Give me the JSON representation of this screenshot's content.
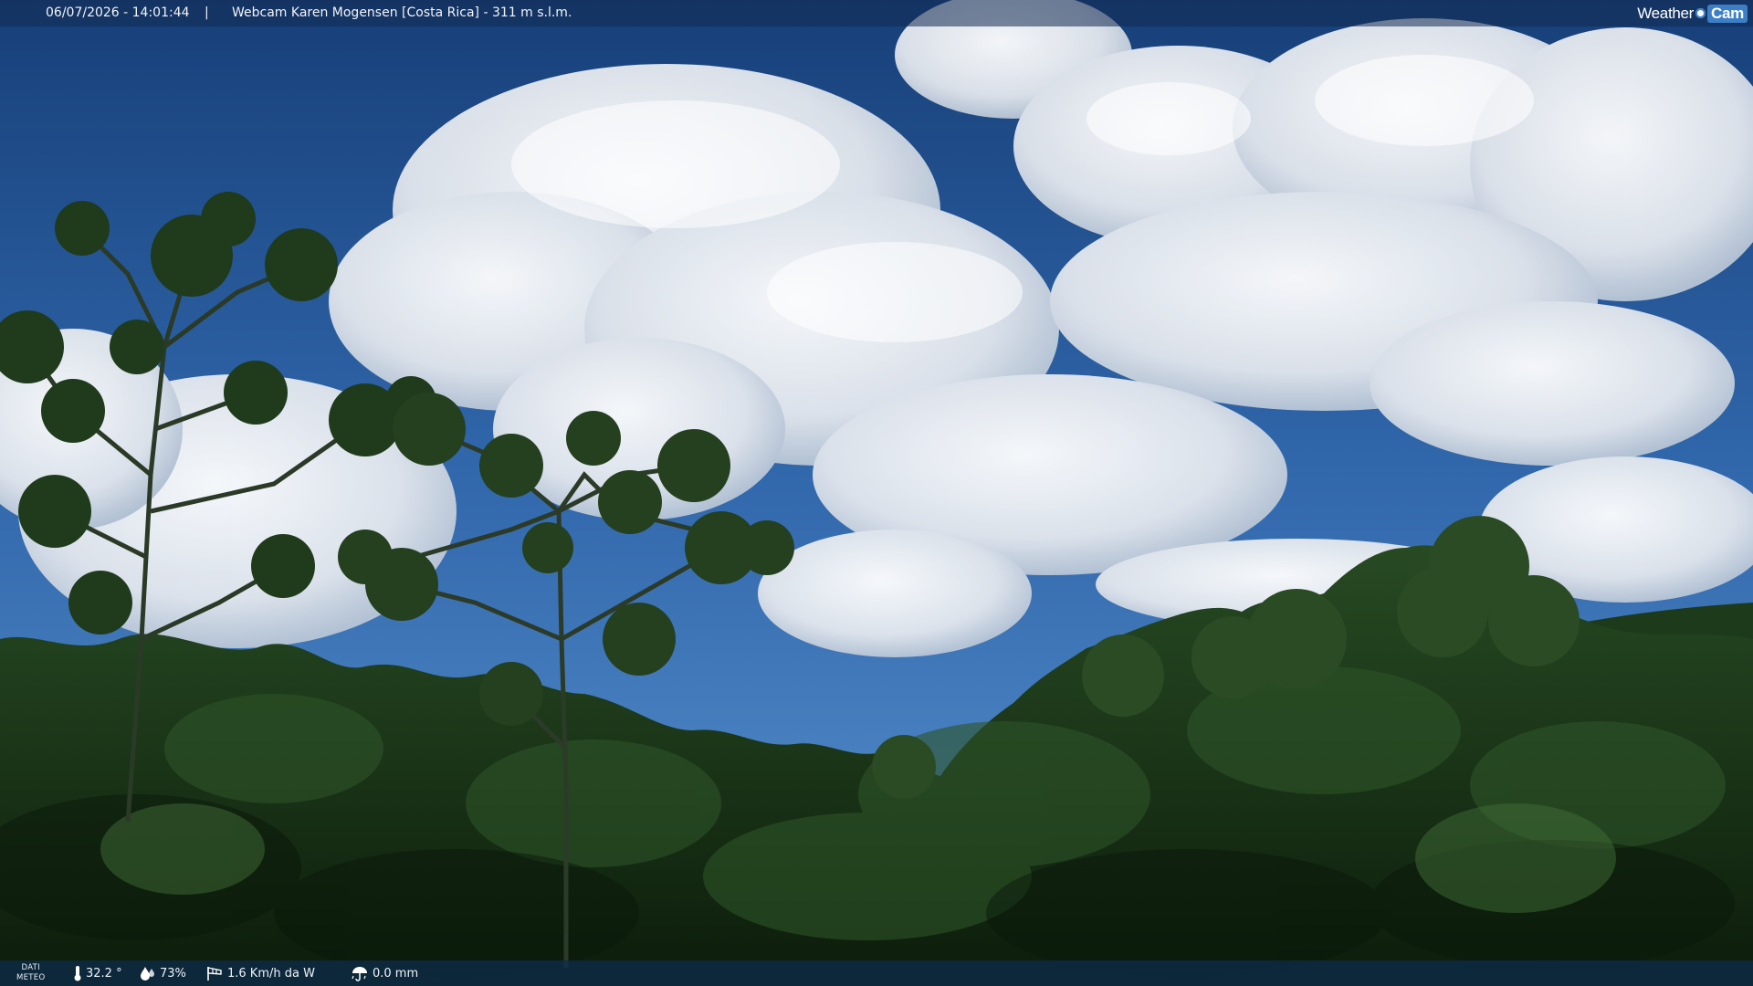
{
  "overlay": {
    "datetime": "06/07/2026 - 14:01:44",
    "separator": "|",
    "title": "Webcam Karen Mogensen [Costa Rica]  - 311 m s.l.m.",
    "brand_left": "Weather",
    "brand_right": "Cam",
    "brand_color": "#3d7fc7"
  },
  "meteo": {
    "label_line1": "DATI",
    "label_line2": "METEO",
    "temperature": "32.2 °",
    "temperature_icon": "thermometer-icon",
    "humidity": "73%",
    "humidity_icon": "humidity-drops-icon",
    "wind": "1.6 Km/h da W",
    "wind_icon": "wind-sock-icon",
    "rain": "0.0 mm",
    "rain_icon": "rain-umbrella-icon"
  },
  "colors": {
    "sky_top": "#1c4a86",
    "sky_mid": "#3a72b8",
    "cloud": "#eef1f4",
    "forest_dark": "#10240f",
    "forest_mid": "#22401c"
  }
}
